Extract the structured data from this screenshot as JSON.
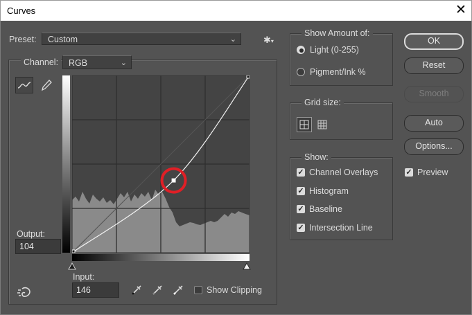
{
  "window": {
    "title": "Curves",
    "close_glyph": "✕"
  },
  "preset": {
    "label": "Preset:",
    "value": "Custom"
  },
  "channel": {
    "label": "Channel:",
    "value": "RGB"
  },
  "output": {
    "label": "Output:",
    "value": "104"
  },
  "input": {
    "label": "Input:",
    "value": "146"
  },
  "show_clipping": {
    "label": "Show Clipping",
    "checked": false
  },
  "show_amount": {
    "title": "Show Amount of:",
    "options": [
      {
        "label": "Light  (0-255)",
        "selected": true
      },
      {
        "label": "Pigment/Ink %",
        "selected": false
      }
    ]
  },
  "grid_size": {
    "title": "Grid size:"
  },
  "show": {
    "title": "Show:",
    "items": [
      {
        "label": "Channel Overlays",
        "checked": true
      },
      {
        "label": "Histogram",
        "checked": true
      },
      {
        "label": "Baseline",
        "checked": true
      },
      {
        "label": "Intersection Line",
        "checked": true
      }
    ]
  },
  "buttons": {
    "ok": "OK",
    "reset": "Reset",
    "smooth": "Smooth",
    "auto": "Auto",
    "options": "Options..."
  },
  "preview": {
    "label": "Preview",
    "checked": true
  },
  "colors": {
    "highlight_circle": "#e01f26",
    "graph_bg": "#444444",
    "histogram": "#8a8a8a"
  },
  "curve": {
    "input_range": [
      0,
      255
    ],
    "output_range": [
      0,
      255
    ],
    "points": [
      [
        0,
        0
      ],
      [
        146,
        104
      ],
      [
        255,
        255
      ]
    ]
  },
  "icons": [
    "curve-tool-icon",
    "pencil-icon",
    "gear-icon",
    "black-eyedropper-icon",
    "gray-eyedropper-icon",
    "white-eyedropper-icon",
    "hand-adjust-icon",
    "grid-4-icon",
    "grid-10-icon"
  ]
}
